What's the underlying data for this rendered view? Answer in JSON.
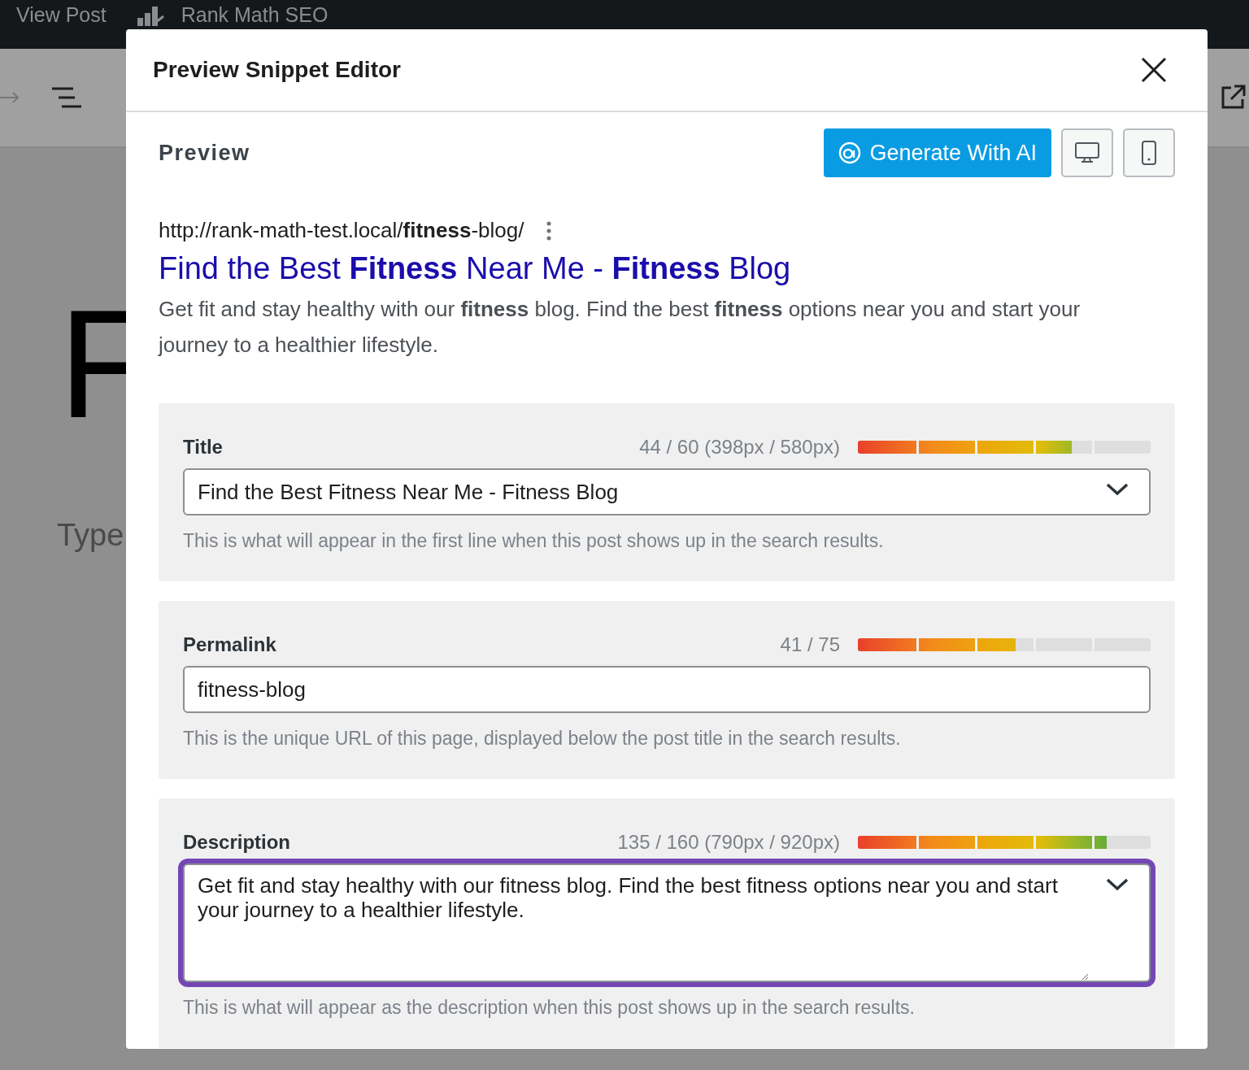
{
  "admin_bar": {
    "items": [
      "View Post",
      "Rank Math SEO"
    ]
  },
  "editor": {
    "heading_letter": "F",
    "placeholder": "Type"
  },
  "modal": {
    "title": "Preview Snippet Editor",
    "preview": {
      "heading": "Preview",
      "generate_button": "Generate With AI",
      "devices": [
        {
          "kind": "desktop"
        },
        {
          "kind": "mobile"
        }
      ]
    },
    "snippet": {
      "url": "http://rank-math-test.local/**fitness**-blog/",
      "title": "Find the Best **Fitness** Near Me - **Fitness** Blog",
      "description": "Get fit and stay healthy with our **fitness** blog. Find the best **fitness** options near you and start your journey to a healthier lifestyle."
    },
    "fields": [
      {
        "kind": "select",
        "label": "Title",
        "counter": "44 / 60 (398px / 580px)",
        "level": 0.73,
        "value": "Find the Best Fitness Near Me - Fitness Blog",
        "hint": "This is what will appear in the first line when this post shows up in the search results.",
        "focused": false
      },
      {
        "kind": "text",
        "label": "Permalink",
        "counter": "41 / 75",
        "level": 0.54,
        "value": "fitness-blog",
        "hint": "This is the unique URL of this page, displayed below the post title in the search results.",
        "focused": false
      },
      {
        "kind": "textarea",
        "label": "Description",
        "counter": "135 / 160 (790px / 920px)",
        "level": 0.85,
        "value": "Get fit and stay healthy with our fitness blog. Find the best fitness options near you and start your journey to a healthier lifestyle.",
        "hint": "This is what will appear as the description when this post shows up in the search results.",
        "focused": true
      }
    ]
  }
}
